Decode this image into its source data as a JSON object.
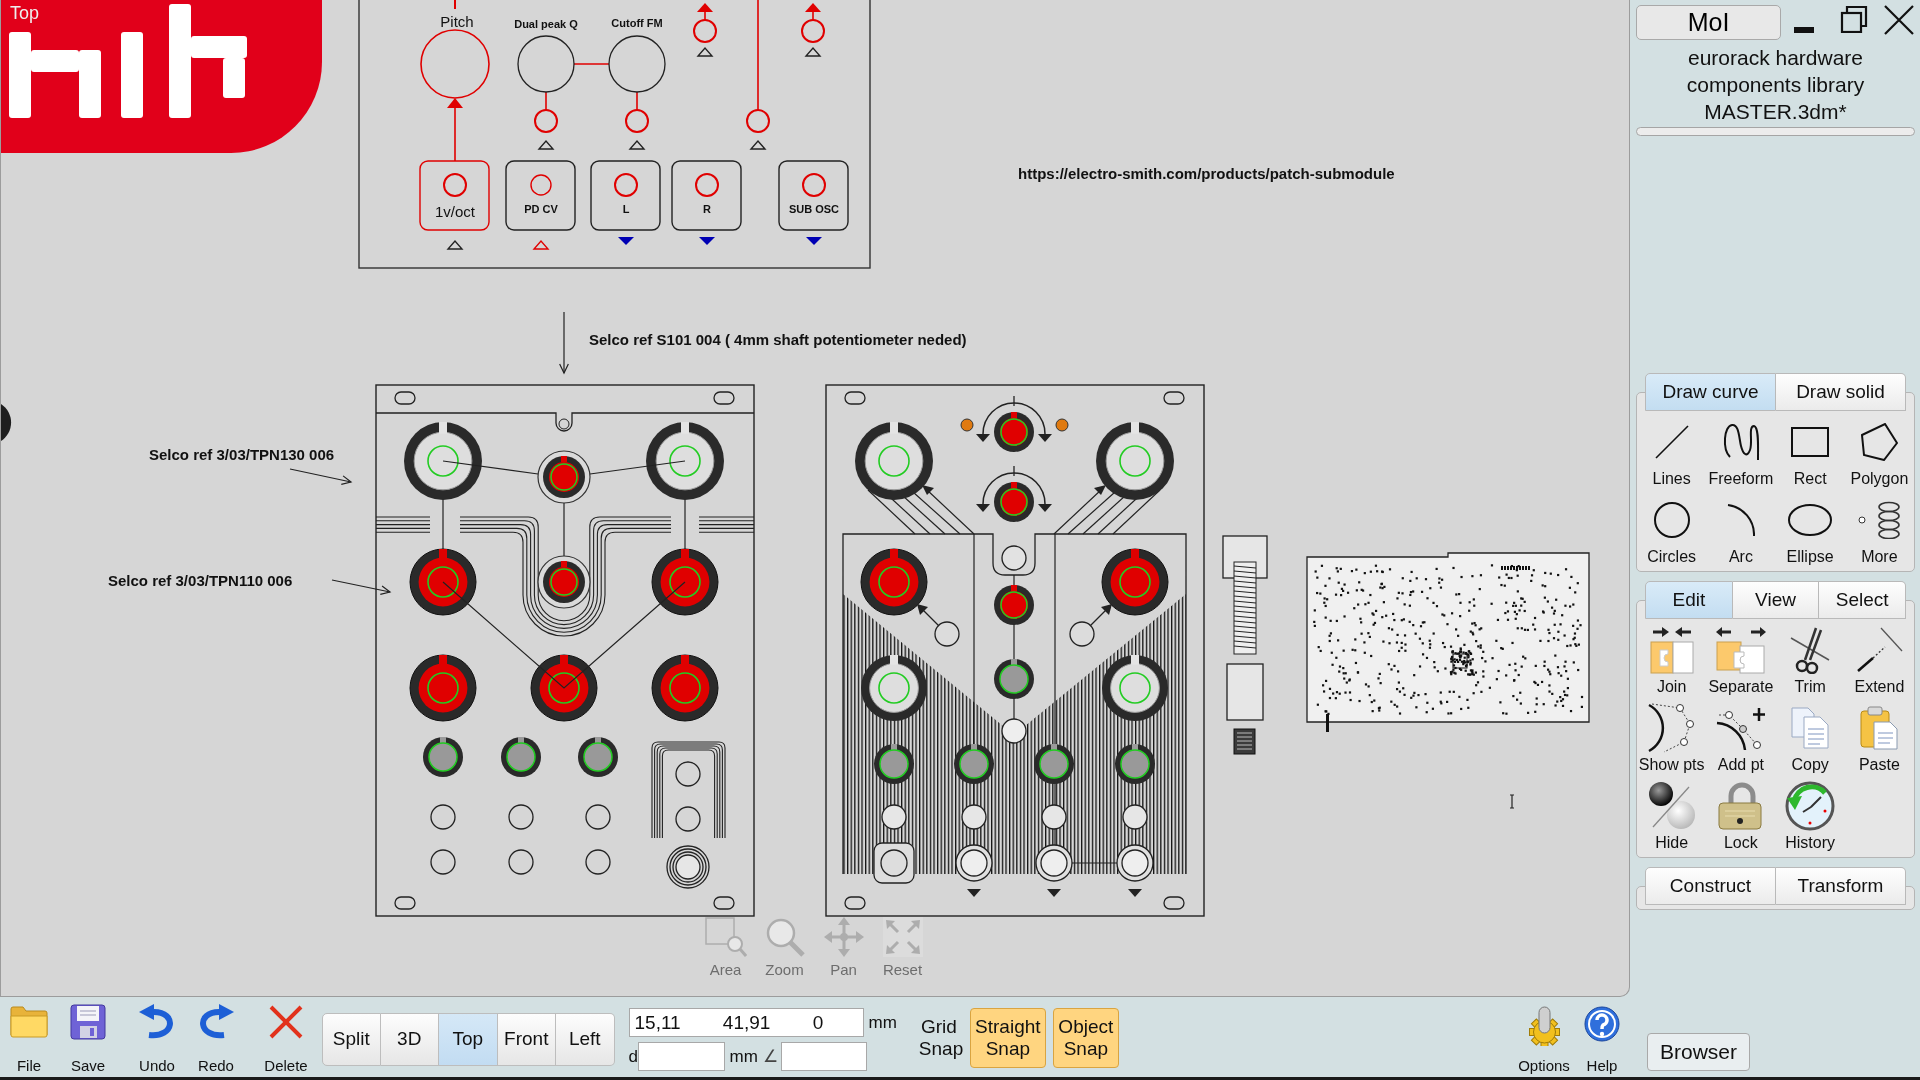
{
  "viewport": {
    "label": "Top",
    "schematic": {
      "knobs": [
        {
          "label": "Pitch"
        },
        {
          "label": "Dual peak Q"
        },
        {
          "label": "Cutoff FM"
        }
      ],
      "jacks": [
        {
          "label": "1v/oct",
          "kind": "input"
        },
        {
          "label": "PD CV",
          "kind": "input"
        },
        {
          "label": "L",
          "kind": "output"
        },
        {
          "label": "R",
          "kind": "output"
        },
        {
          "label": "SUB OSC",
          "kind": "output"
        }
      ]
    },
    "notes": [
      {
        "text": "https://electro-smith.com/products/patch-submodule"
      },
      {
        "text": "Selco ref S101 004 ( 4mm shaft potentiometer neded)"
      },
      {
        "text": "Selco ref 3/03/TPN130 006"
      },
      {
        "text": "Selco ref 3/03/TPN110 006"
      }
    ],
    "view_tools": [
      {
        "label": "Area",
        "disabled": true
      },
      {
        "label": "Zoom",
        "disabled": true
      },
      {
        "label": "Pan",
        "disabled": true
      },
      {
        "label": "Reset",
        "disabled": true
      }
    ]
  },
  "side_panel": {
    "app_button": "MoI",
    "document_title": "eurorack hardware components library MASTER.3dm*",
    "palettes": [
      {
        "tabs": [
          {
            "label": "Draw curve",
            "selected": true
          },
          {
            "label": "Draw solid",
            "selected": false
          }
        ],
        "tools": [
          {
            "label": "Lines"
          },
          {
            "label": "Freeform"
          },
          {
            "label": "Rect"
          },
          {
            "label": "Polygon"
          },
          {
            "label": "Circles"
          },
          {
            "label": "Arc"
          },
          {
            "label": "Ellipse"
          },
          {
            "label": "More"
          }
        ]
      },
      {
        "tabs": [
          {
            "label": "Edit",
            "selected": true
          },
          {
            "label": "View",
            "selected": false
          },
          {
            "label": "Select",
            "selected": false
          }
        ],
        "tools": [
          {
            "label": "Join"
          },
          {
            "label": "Separate"
          },
          {
            "label": "Trim"
          },
          {
            "label": "Extend"
          },
          {
            "label": "Show pts"
          },
          {
            "label": "Add pt"
          },
          {
            "label": "Copy"
          },
          {
            "label": "Paste"
          },
          {
            "label": "Hide"
          },
          {
            "label": "Lock"
          },
          {
            "label": "History"
          }
        ]
      },
      {
        "tabs": [
          {
            "label": "Construct",
            "selected": false
          },
          {
            "label": "Transform",
            "selected": false
          }
        ]
      }
    ]
  },
  "toolbar": {
    "commands": [
      {
        "label": "File"
      },
      {
        "label": "Save"
      },
      {
        "label": "Undo"
      },
      {
        "label": "Redo"
      },
      {
        "label": "Delete"
      }
    ],
    "views": [
      {
        "label": "Split",
        "selected": false
      },
      {
        "label": "3D",
        "selected": false
      },
      {
        "label": "Top",
        "selected": true
      },
      {
        "label": "Front",
        "selected": false
      },
      {
        "label": "Left",
        "selected": false
      }
    ],
    "coordinates": {
      "value": "15,11        41,91        0",
      "unit": "mm"
    },
    "distance": {
      "label": "d",
      "unit": "mm"
    },
    "angle": {
      "label": "∠"
    },
    "snaps": [
      {
        "label": "Grid Snap",
        "on": false
      },
      {
        "label": "Straight Snap",
        "on": true
      },
      {
        "label": "Object Snap",
        "on": true
      }
    ],
    "utilities": [
      {
        "label": "Options"
      },
      {
        "label": "Help"
      }
    ],
    "browser_button": "Browser"
  }
}
